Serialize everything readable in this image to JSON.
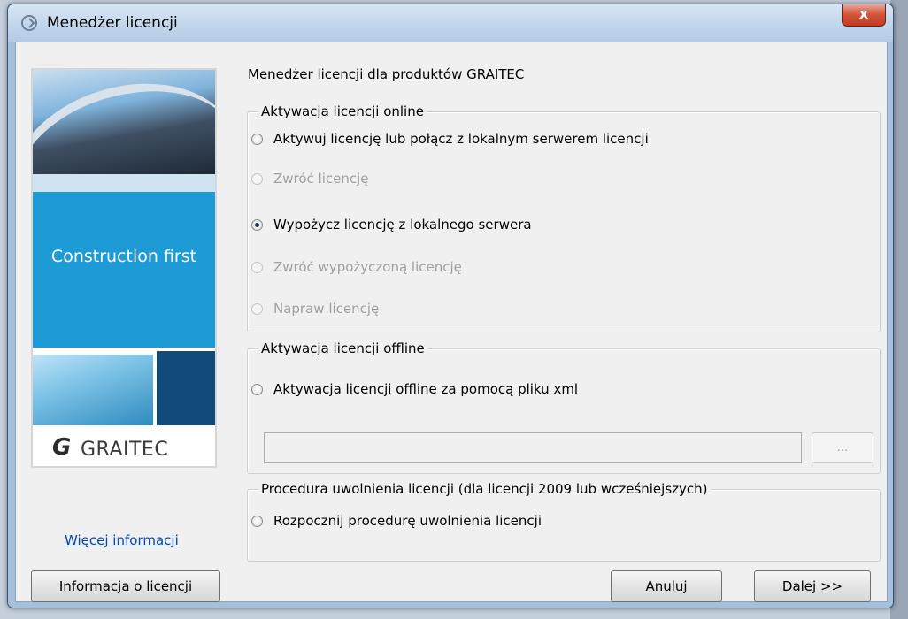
{
  "window": {
    "title": "Menedżer licencji",
    "close_label": "x"
  },
  "banner": {
    "slogan": "Construction first",
    "logo_letter": "G",
    "logo_text": "GRAITEC"
  },
  "more_info_link": "Więcej informacji",
  "header": "Menedżer licencji dla produktów GRAITEC",
  "online_group": {
    "legend": "Aktywacja licencji online",
    "options": [
      {
        "label": "Aktywuj licencję lub połącz z lokalnym serwerem licencji",
        "enabled": true,
        "checked": false
      },
      {
        "label": "Zwróć licencję",
        "enabled": false,
        "checked": false
      },
      {
        "label": "Wypożycz licencję z lokalnego serwera",
        "enabled": true,
        "checked": true
      },
      {
        "label": "Zwróć wypożyczoną licencję",
        "enabled": false,
        "checked": false
      },
      {
        "label": "Napraw licencję",
        "enabled": false,
        "checked": false
      }
    ]
  },
  "offline_group": {
    "legend": "Aktywacja licencji offline",
    "option": "Aktywacja licencji offline za pomocą pliku xml",
    "path_value": "",
    "browse_label": "..."
  },
  "release_group": {
    "legend": "Procedura uwolnienia licencji (dla licencji 2009 lub wcześniejszych)",
    "option": "Rozpocznij procedurę uwolnienia licencji"
  },
  "buttons": {
    "license_info": "Informacja o licencji",
    "cancel": "Anuluj",
    "next": "Dalej >>"
  }
}
